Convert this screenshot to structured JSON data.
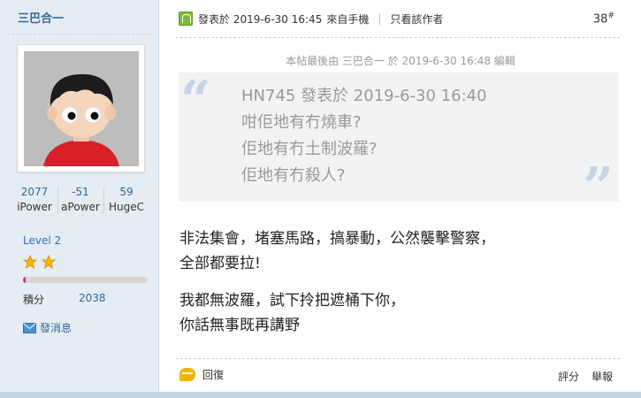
{
  "author": {
    "username": "三巴合一",
    "stats": [
      {
        "value": "2077",
        "label": "iPower"
      },
      {
        "value": "-51",
        "label": "aPower"
      },
      {
        "value": "59",
        "label": "HugeC"
      }
    ],
    "level": "Level 2",
    "stars_count": 2,
    "level_progress": 0.02,
    "score_label": "積分",
    "score_value": "2038",
    "pm_label": "發消息"
  },
  "post": {
    "posted_at": "發表於 2019-6-30 16:45",
    "source": "來自手機",
    "separator": "|",
    "only_author": "只看該作者",
    "floor": "38",
    "floor_sign": "#",
    "edited_note": "本帖最後由 三巴合一 於 2019-6-30 16:48 編輯",
    "quote": {
      "header": "HN745 發表於 2019-6-30 16:40",
      "lines": [
        "咁佢地有冇燒車?",
        "佢地有冇土制波羅?",
        "佢地有冇殺人?"
      ]
    },
    "paragraphs": [
      [
        "非法集會，堵塞馬路，搞暴動，公然襲擊警察，",
        "全部都要拉!"
      ],
      [
        "我都無波羅，試下拎把遮桶下你，",
        "你話無事既再講野"
      ]
    ],
    "reply_label": "回復",
    "rate_label": "評分",
    "report_label": "舉報"
  },
  "colors": {
    "sidebar_bg": "#e5edf2",
    "link": "#336699",
    "level_bar": "#e0338b",
    "quote_bg": "#f3f3f3"
  }
}
